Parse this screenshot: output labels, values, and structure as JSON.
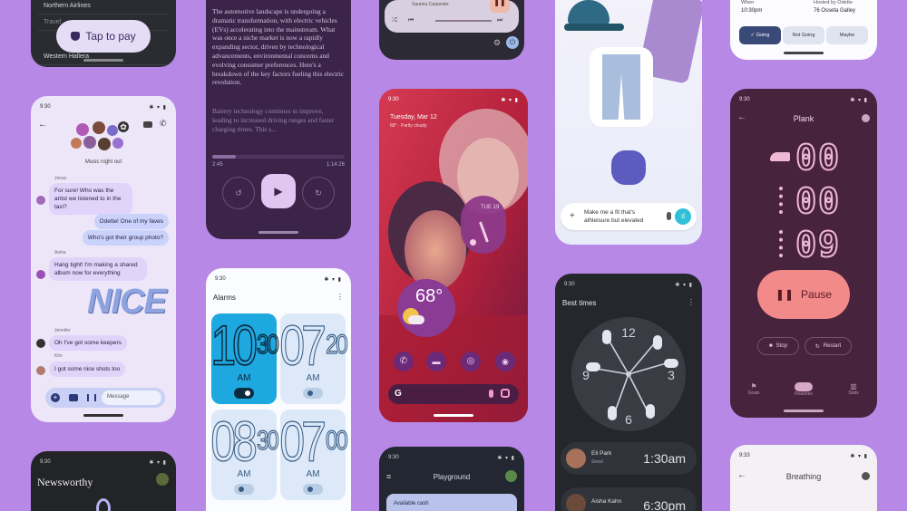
{
  "wallet": {
    "rows": [
      "Northern Airlines",
      "Travel",
      "Western Hallera"
    ],
    "tap_to_pay": "Tap to pay"
  },
  "chat": {
    "time": "9:30",
    "group_name": "Music night out",
    "messages": [
      {
        "sender": "Jonas",
        "text": "For sure! Who was the artist we listened to in the taxi?",
        "side": "left"
      },
      {
        "sender": "",
        "text": "Odette! One of my faves",
        "side": "right"
      },
      {
        "sender": "",
        "text": "Who's got their group photo?",
        "side": "right"
      },
      {
        "sender": "Aisha",
        "text": "Hang tight! I'm making a shared album now for everything",
        "side": "left"
      },
      {
        "sender": "Jennifer",
        "text": "Oh I've got some keepers",
        "side": "left"
      },
      {
        "sender": "Kim",
        "text": "I got some nice shots too",
        "side": "left"
      }
    ],
    "sticker": "NICE",
    "input_placeholder": "Message"
  },
  "reader": {
    "paragraph1": "The automotive landscape is undergoing a dramatic transformation, with electric vehicles (EVs) accelerating into the mainstream. What was once a niche market is now a rapidly expanding sector, driven by technological advancements, environmental concerns and evolving consumer preferences. Here's a breakdown of the key factors fueling this electric revolution.",
    "paragraph2": "Battery technology continues to improve, leading to increased driving ranges and faster charging times. This s...",
    "elapsed": "2:45",
    "total": "1:14:26",
    "progress": 0.18
  },
  "media": {
    "artist": "Saunna Carpenter"
  },
  "home": {
    "time": "9:30",
    "date": "Tuesday, Mar 12",
    "weather_line": "68° · Partly cloudy",
    "clock_label": "TUE 19",
    "temperature": "68°"
  },
  "shop": {
    "prompt": "Make me a fit that's athleisure but elevated"
  },
  "event": {
    "label_left": "When",
    "label_right": "Hosted by Odette",
    "time": "10:30pm",
    "place": "76 Osseta Galley",
    "rsvp": [
      "Going",
      "Not Going",
      "Maybe"
    ]
  },
  "stopwatch": {
    "time": "9:30",
    "title": "Plank",
    "digits": [
      "00",
      "00",
      "09"
    ],
    "pause_label": "Pause",
    "stop_label": "Stop",
    "restart_label": "Restart",
    "nav": [
      "Goals",
      "Routines",
      "Stats"
    ]
  },
  "alarms": {
    "time": "9:30",
    "title": "Alarms",
    "items": [
      {
        "hour": "10",
        "min": "30",
        "ampm": "AM",
        "on": true
      },
      {
        "hour": "07",
        "min": "20",
        "ampm": "AM",
        "on": false
      },
      {
        "hour": "08",
        "min": "30",
        "ampm": "AM",
        "on": false
      },
      {
        "hour": "07",
        "min": "00",
        "ampm": "AM",
        "on": false
      }
    ]
  },
  "clock_app": {
    "time": "9:30",
    "title": "Best times",
    "numerals": [
      "12",
      "3",
      "6",
      "9"
    ],
    "contacts": [
      {
        "name": "Eli Park",
        "place": "Seoul",
        "time": "1:30am"
      },
      {
        "name": "Aisha Kahn",
        "place": "",
        "time": "6:30pm"
      }
    ]
  },
  "news": {
    "time": "9:30",
    "title": "Newsworthy"
  },
  "playground": {
    "time": "9:30",
    "title": "Playground",
    "card": "Available cash"
  },
  "breathing": {
    "time": "9:33",
    "title": "Breathing"
  }
}
